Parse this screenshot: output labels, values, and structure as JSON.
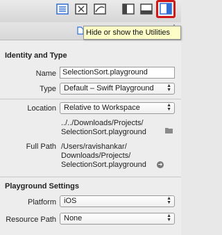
{
  "tooltip": {
    "text": "Hide or show the Utilities"
  },
  "identity": {
    "header": "Identity and Type",
    "name_label": "Name",
    "name_value": "SelectionSort.playground",
    "type_label": "Type",
    "type_value": "Default – Swift Playground",
    "location_label": "Location",
    "location_value": "Relative to Workspace",
    "relative_path_line1": "../../Downloads/Projects/",
    "relative_path_line2": "SelectionSort.playground",
    "full_path_label": "Full Path",
    "full_path_line1": "/Users/ravishankar/",
    "full_path_line2": "Downloads/Projects/",
    "full_path_line3": "SelectionSort.playground"
  },
  "playground": {
    "header": "Playground Settings",
    "platform_label": "Platform",
    "platform_value": "iOS",
    "resource_label": "Resource Path",
    "resource_value": "None"
  },
  "icons": {
    "toolbar": [
      "standard-editor-icon",
      "assistant-editor-icon",
      "version-editor-icon",
      "navigator-toggle-icon",
      "debug-area-toggle-icon",
      "utilities-toggle-icon"
    ],
    "inspector": [
      "file-inspector-icon",
      "quick-help-icon"
    ]
  },
  "colors": {
    "highlight": "#d01818",
    "selected_blue": "#2f6fd6",
    "tooltip_bg": "#fdfdc8"
  }
}
